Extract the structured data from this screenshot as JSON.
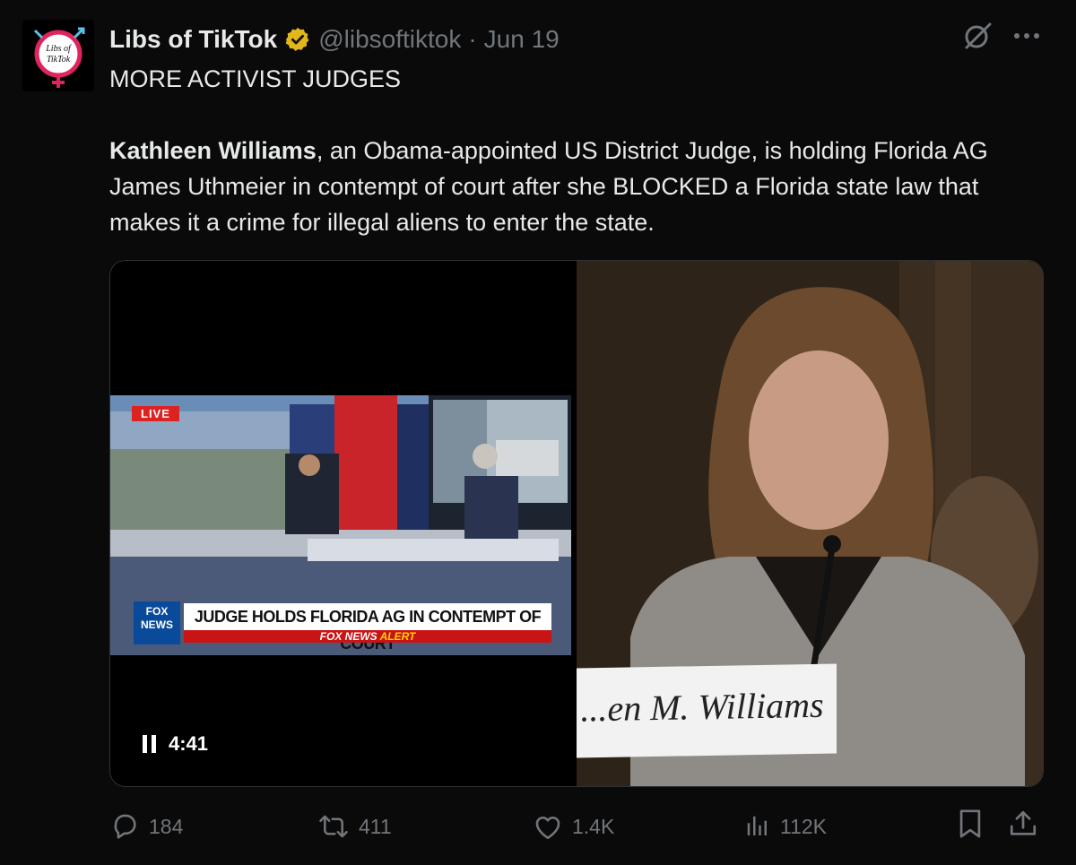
{
  "author": {
    "display_name": "Libs of TikTok",
    "avatar_text": "Libs of TikTok",
    "handle": "@libsoftiktok",
    "separator": "·",
    "date": "Jun 19"
  },
  "tweet": {
    "headline": "MORE ACTIVIST JUDGES",
    "body_name": "Kathleen Williams",
    "body_rest": ", an Obama-appointed US District Judge, is holding Florida AG James Uthmeier in contempt of court after she BLOCKED a Florida state law that makes it a crime for illegal aliens to enter the state."
  },
  "media": {
    "live_badge": "LIVE",
    "network_logo": "FOX NEWS",
    "chyron": "JUDGE HOLDS FLORIDA AG IN CONTEMPT OF COURT",
    "alert_prefix": "FOX NEWS",
    "alert_word": "ALERT",
    "nameplate": "...en M. Williams",
    "duration": "4:41",
    "state": "playing"
  },
  "engagement": {
    "replies": "184",
    "reposts": "411",
    "likes": "1.4K",
    "views": "112K"
  },
  "icons": [
    "verified-badge-icon",
    "grok-icon",
    "more-icon",
    "pause-icon",
    "reply-icon",
    "repost-icon",
    "like-icon",
    "views-icon",
    "bookmark-icon",
    "share-icon"
  ],
  "colors": {
    "background": "#0a0a0a",
    "text": "#e7e9ea",
    "muted": "#71767b",
    "verified": "#e2b719"
  }
}
